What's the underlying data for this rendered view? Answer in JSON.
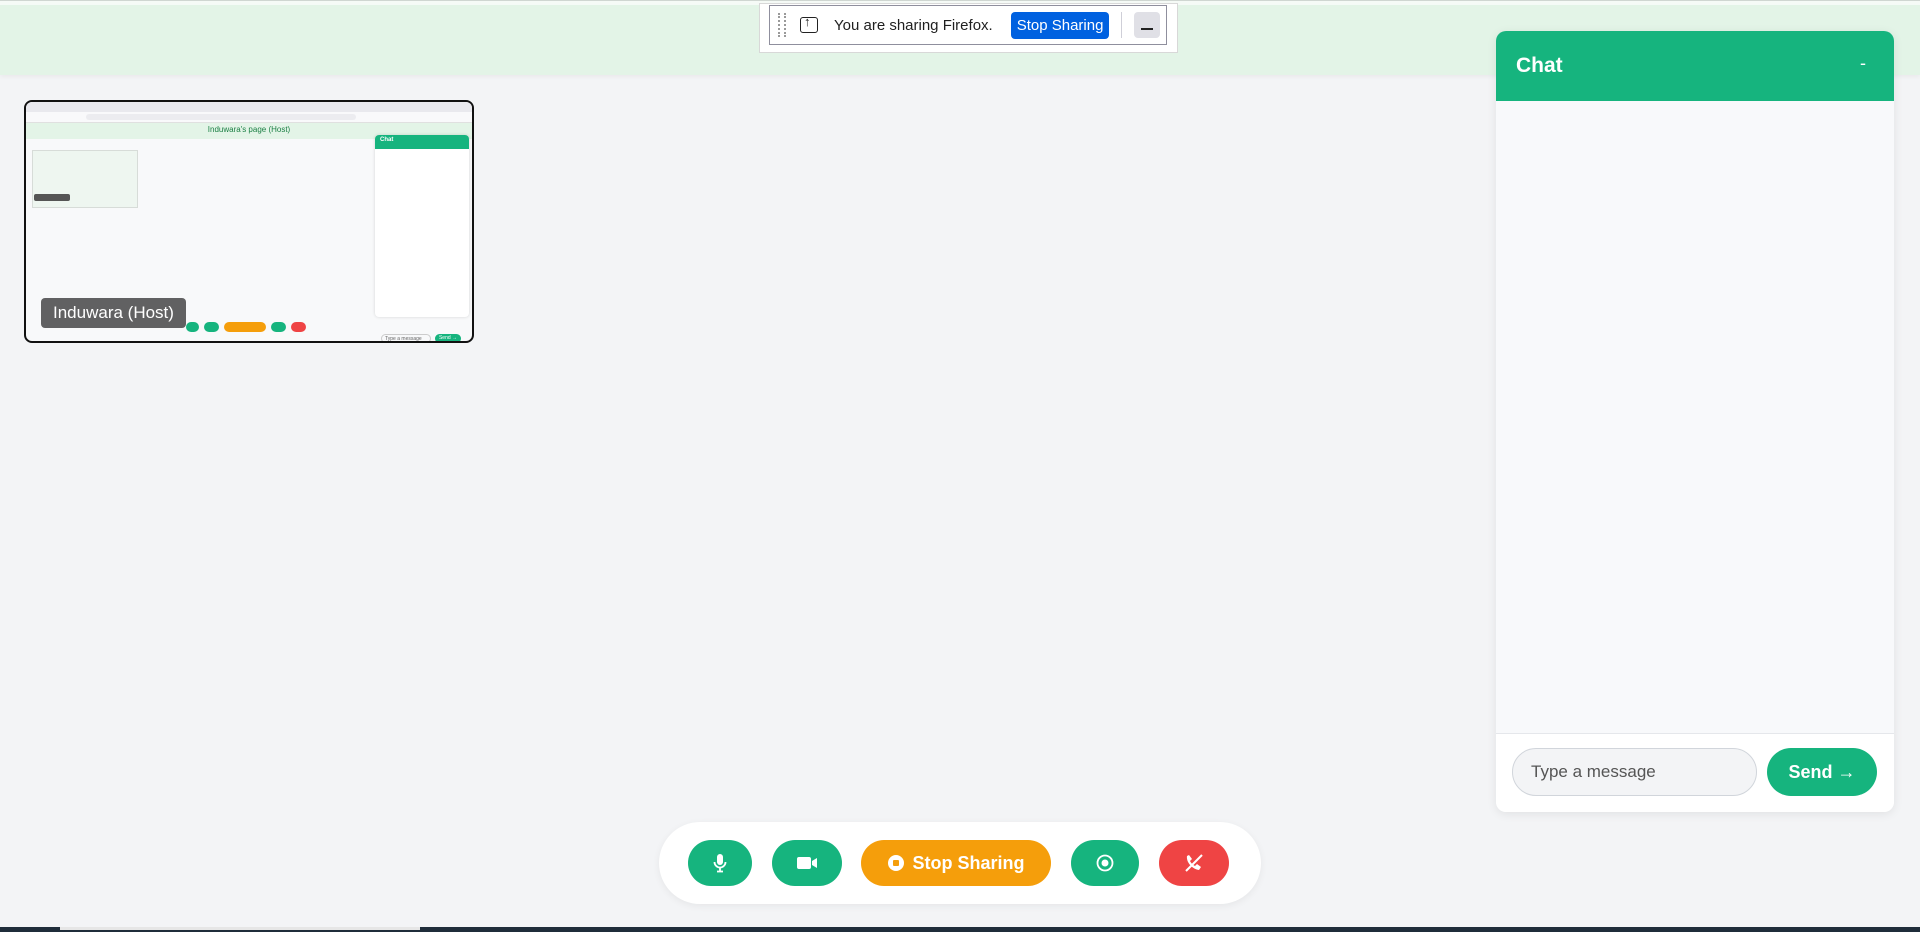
{
  "page": {
    "title": "Induwara's page (Host)"
  },
  "share_indicator": {
    "text": "You are sharing Firefox.",
    "stop_label": "Stop Sharing"
  },
  "video_tile": {
    "label": "Induwara (Host)",
    "preview_title": "Induwara's page (Host)",
    "preview_chat_title": "Chat",
    "preview_input_placeholder": "Type a message",
    "preview_send_label": "Send →"
  },
  "chat": {
    "title": "Chat",
    "minimize_label": "-",
    "input_placeholder": "Type a message",
    "send_label": "Send →"
  },
  "controls": {
    "share_label": "Stop Sharing",
    "icons": [
      "microphone-icon",
      "video-camera-icon",
      "stop-icon",
      "record-icon",
      "end-call-icon"
    ]
  },
  "colors": {
    "primary": "#16b47e",
    "share": "#f59e0b",
    "danger": "#ef4444",
    "header_bg": "#e3f4e7",
    "title": "#22a05a",
    "firefox_blue": "#0061e0"
  }
}
